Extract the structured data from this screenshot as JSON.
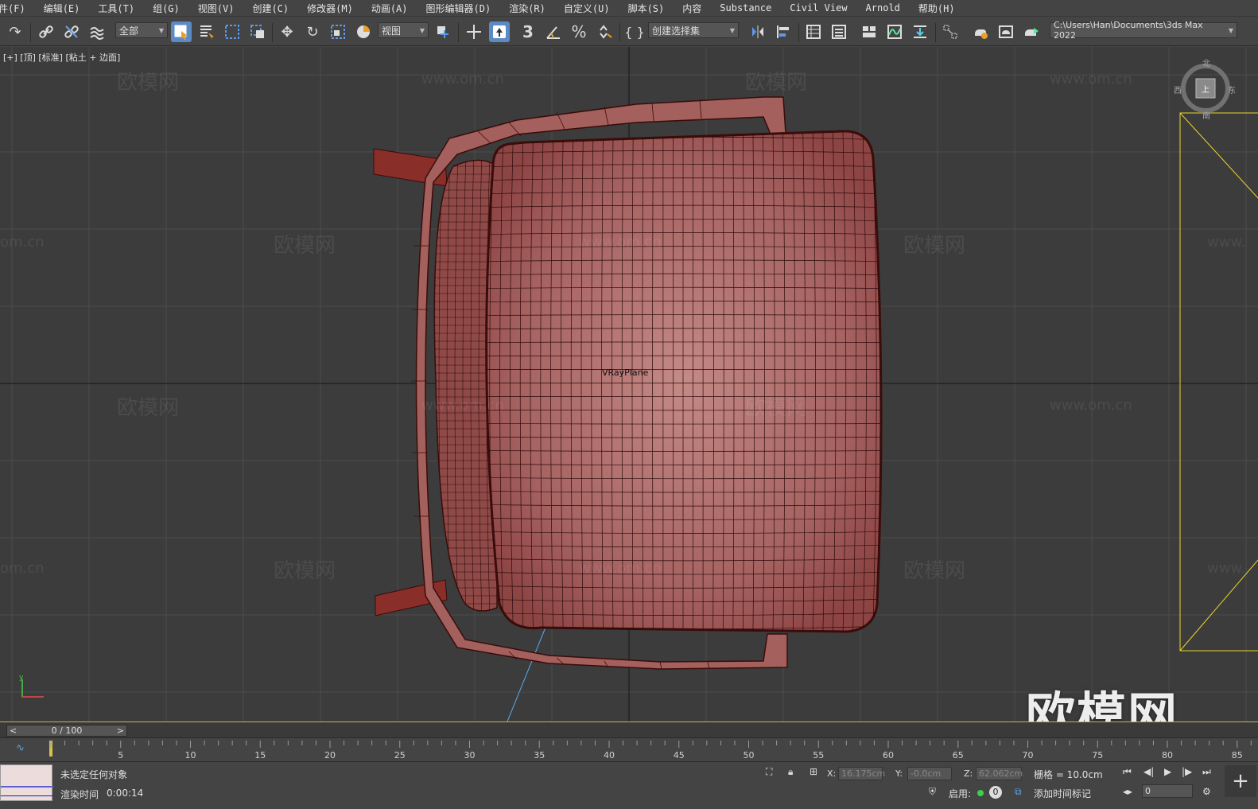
{
  "menubar": {
    "items": [
      "文件(F)",
      "编辑(E)",
      "工具(T)",
      "组(G)",
      "视图(V)",
      "创建(C)",
      "修改器(M)",
      "动画(A)",
      "图形编辑器(D)",
      "渲染(R)",
      "自定义(U)",
      "脚本(S)",
      "内容",
      "Substance",
      "Civil View",
      "Arnold",
      "帮助(H)"
    ]
  },
  "toolbar": {
    "selection_filter": "全部",
    "reference_coord": "视图",
    "named_selection": "创建选择集",
    "project_path": "C:\\Users\\Han\\Documents\\3ds Max 2022",
    "snap_label": "3"
  },
  "viewport": {
    "label": "[+] [顶] [标准] [粘土 + 边面]",
    "object_label": "VRayPlane",
    "watermark_cn": "欧模网",
    "watermark_url": "www.om.cn",
    "watermark_url_partial": "om.cn",
    "watermark_url_left": "www.",
    "big_watermark": "欧模网",
    "viewcube": {
      "north": "北",
      "south": "南",
      "west": "西",
      "east": "东",
      "face": "上"
    }
  },
  "timeline": {
    "frame_display": "0 / 100",
    "ticks": [
      "5",
      "10",
      "15",
      "20",
      "25",
      "30",
      "35",
      "40",
      "45",
      "50",
      "55",
      "60",
      "65",
      "70",
      "75",
      "80",
      "85"
    ]
  },
  "statusbar": {
    "selection_status": "未选定任何对象",
    "render_time_label": "渲染时间",
    "render_time_value": "0:00:14",
    "x_label": "X:",
    "x_value": "16.175cm",
    "y_label": "Y:",
    "y_value": "-0.0cm",
    "z_label": "Z:",
    "z_value": "62.062cm",
    "grid": "栅格 = 10.0cm",
    "enable_label": "启用:",
    "enable_count": "0",
    "add_time_tag": "添加时间标记",
    "frame_field": "0"
  },
  "colors": {
    "viewport_bg": "#3c3c3c",
    "model_fill": "#a96a6a",
    "model_dark": "#6e2a28",
    "wire": "#2a0a0a",
    "accent_active": "#5b8ac5",
    "selection_yellow": "#e8d62a"
  }
}
